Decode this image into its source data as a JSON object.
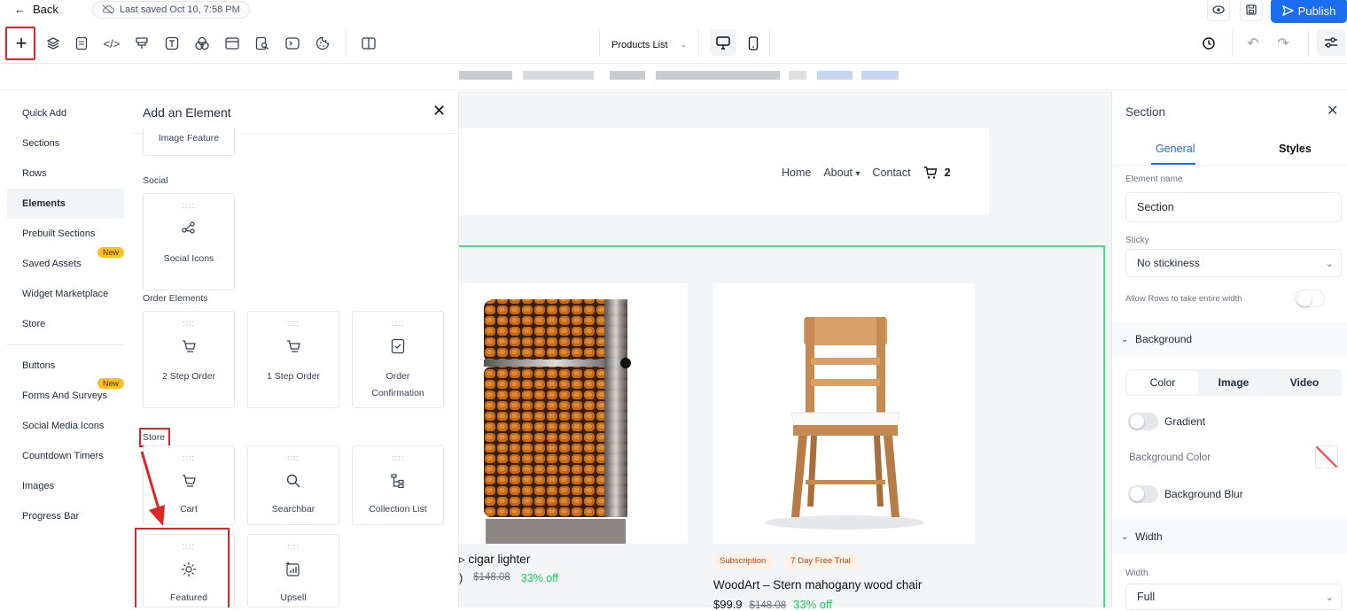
{
  "topbar": {
    "back_label": "Back",
    "saved_text": "Last saved Oct 10, 7:58 PM",
    "publish_label": "Publish"
  },
  "toolbar": {
    "page_select": "Products List"
  },
  "leftnav": {
    "items": [
      "Quick Add",
      "Sections",
      "Rows",
      "Elements",
      "Prebuilt Sections",
      "Saved Assets",
      "Widget Marketplace",
      "Store",
      "Buttons",
      "Forms And Surveys",
      "Social Media Icons",
      "Countdown Timers",
      "Images",
      "Progress Bar"
    ],
    "new_badge": "New"
  },
  "panel": {
    "title": "Add an Element",
    "image_feature": "Image Feature",
    "social_header": "Social",
    "social_icons": "Social Icons",
    "order_header": "Order Elements",
    "order_items": [
      "2 Step Order",
      "1 Step Order",
      "Order Confirmation"
    ],
    "store_header": "Store",
    "store_items": [
      "Cart",
      "Searchbar",
      "Collection List"
    ],
    "store_items2": [
      "Featured",
      "Upsell"
    ],
    "grip": "::::"
  },
  "site": {
    "nav": [
      "Home",
      "About",
      "Contact"
    ],
    "cart_count": "2",
    "product1": {
      "name": "cigar lighter",
      "old_price": "$148.08",
      "discount": "33% off"
    },
    "product2": {
      "tag1": "Subscription",
      "tag2": "7 Day Free Trial",
      "name": "WoodArt – Stern mahogany wood chair",
      "price": "$99.9",
      "old_price": "$148.08",
      "discount": "33% off"
    }
  },
  "right": {
    "title": "Section",
    "tabs": [
      "General",
      "Styles"
    ],
    "element_name_label": "Element name",
    "element_name": "Section",
    "sticky_label": "Sticky",
    "sticky_value": "No stickiness",
    "allow_rows": "Allow Rows to take entire width",
    "background_header": "Background",
    "bg_tabs": [
      "Color",
      "Image",
      "Video"
    ],
    "gradient": "Gradient",
    "bg_color": "Background Color",
    "bg_blur": "Background Blur",
    "width_header": "Width",
    "width_label": "Width",
    "width_value": "Full"
  },
  "colors": {
    "accent": "#1d6df0",
    "highlight": "#dc2626",
    "selection": "#4ade80",
    "discount": "#22c55e"
  }
}
